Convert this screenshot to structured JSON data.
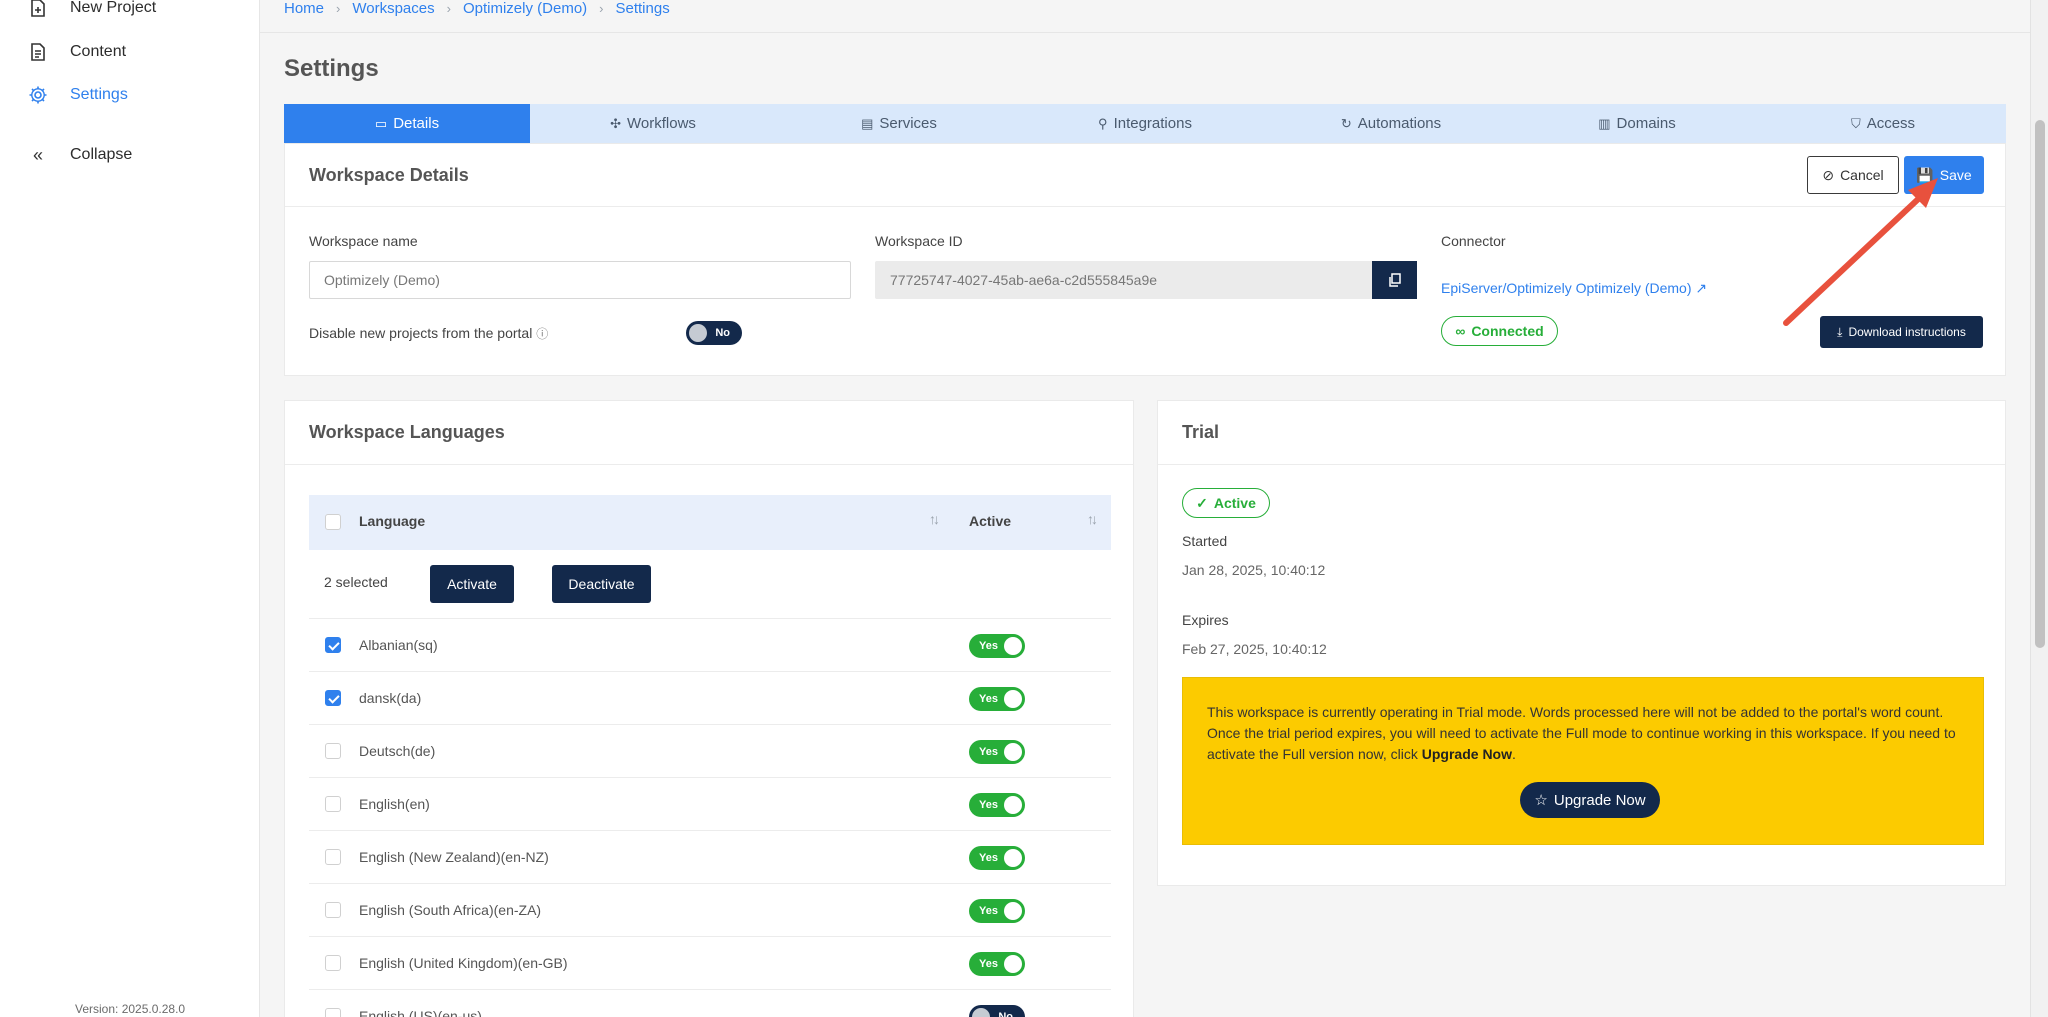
{
  "sidebar": {
    "items": [
      {
        "label": "New Project"
      },
      {
        "label": "Content"
      },
      {
        "label": "Settings"
      },
      {
        "label": "Collapse"
      }
    ],
    "version": "Version: 2025.0.28.0"
  },
  "breadcrumb": [
    "Home",
    "Workspaces",
    "Optimizely (Demo)",
    "Settings"
  ],
  "page_title": "Settings",
  "tabs": [
    {
      "label": "Details",
      "icon": "tablet-icon"
    },
    {
      "label": "Workflows",
      "icon": "nodes-icon"
    },
    {
      "label": "Services",
      "icon": "server-icon"
    },
    {
      "label": "Integrations",
      "icon": "plug-icon"
    },
    {
      "label": "Automations",
      "icon": "sync-icon"
    },
    {
      "label": "Domains",
      "icon": "building-icon"
    },
    {
      "label": "Access",
      "icon": "shield-icon"
    }
  ],
  "details": {
    "title": "Workspace Details",
    "cancel": "Cancel",
    "save": "Save",
    "workspace_name_label": "Workspace name",
    "workspace_name_value": "Optimizely (Demo)",
    "disable_label": "Disable new projects from the portal",
    "disable_toggle": "No",
    "workspace_id_label": "Workspace ID",
    "workspace_id_value": "77725747-4027-45ab-ae6a-c2d555845a9e",
    "connector_label": "Connector",
    "connector_link": "EpiServer/Optimizely Optimizely (Demo)",
    "connected": "Connected",
    "download": "Download instructions"
  },
  "languages": {
    "title": "Workspace Languages",
    "col_language": "Language",
    "col_active": "Active",
    "selected_text": "2 selected",
    "activate": "Activate",
    "deactivate": "Deactivate",
    "rows": [
      {
        "name": "Albanian(sq)",
        "checked": true,
        "active": "Yes"
      },
      {
        "name": "dansk(da)",
        "checked": true,
        "active": "Yes"
      },
      {
        "name": "Deutsch(de)",
        "checked": false,
        "active": "Yes"
      },
      {
        "name": "English(en)",
        "checked": false,
        "active": "Yes"
      },
      {
        "name": "English (New Zealand)(en-NZ)",
        "checked": false,
        "active": "Yes"
      },
      {
        "name": "English (South Africa)(en-ZA)",
        "checked": false,
        "active": "Yes"
      },
      {
        "name": "English (United Kingdom)(en-GB)",
        "checked": false,
        "active": "Yes"
      },
      {
        "name": "English (US)(en-us)",
        "checked": false,
        "active": "No"
      }
    ]
  },
  "trial": {
    "title": "Trial",
    "status": "Active",
    "started_label": "Started",
    "started_value": "Jan 28, 2025, 10:40:12",
    "expires_label": "Expires",
    "expires_value": "Feb 27, 2025, 10:40:12",
    "notice_part1": "This workspace is currently operating in Trial mode. Words processed here will not be added to the portal's word count. Once the trial period expires, you will need to activate the Full mode to continue working in this workspace. If you need to activate the Full version now, click ",
    "notice_bold": "Upgrade Now",
    "notice_end": ".",
    "upgrade": "Upgrade Now"
  },
  "colors": {
    "accent": "#2f80ed",
    "navy": "#13294b",
    "success": "#27ae39",
    "warning": "#fccb00",
    "annotation_arrow": "#e8513d"
  }
}
